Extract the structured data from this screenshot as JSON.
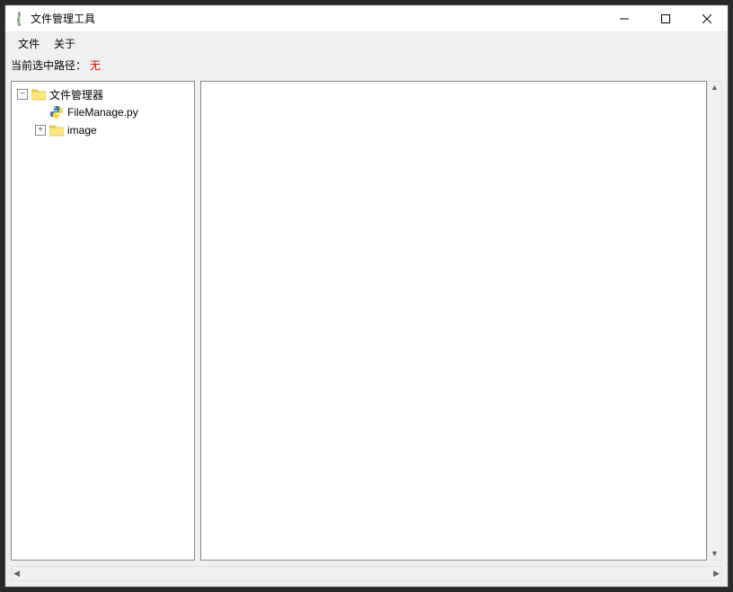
{
  "window": {
    "title": "文件管理工具"
  },
  "menu": {
    "file": "文件",
    "about": "关于"
  },
  "pathbar": {
    "label": "当前选中路径：",
    "value": "无"
  },
  "tree": {
    "root": {
      "label": "文件管理器",
      "expanded": true
    },
    "children": [
      {
        "label": "FileManage.py",
        "type": "pyfile"
      },
      {
        "label": "image",
        "type": "folder",
        "expanded": false
      }
    ]
  }
}
